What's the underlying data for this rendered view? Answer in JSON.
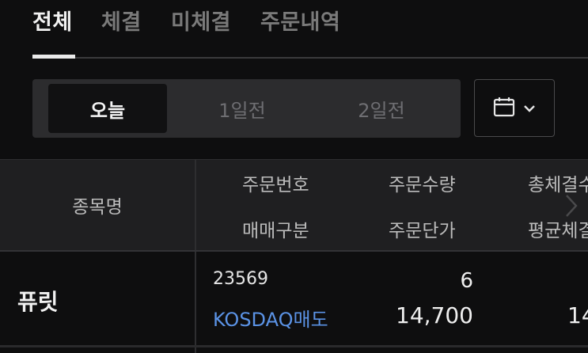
{
  "tabs": [
    {
      "label": "전체",
      "active": true
    },
    {
      "label": "체결",
      "active": false
    },
    {
      "label": "미체결",
      "active": false
    },
    {
      "label": "주문내역",
      "active": false
    }
  ],
  "date_filter": {
    "options": [
      {
        "label": "오늘",
        "active": true
      },
      {
        "label": "1일전",
        "active": false
      },
      {
        "label": "2일전",
        "active": false
      }
    ],
    "calendar_icon": "calendar-icon",
    "dropdown_icon": "chevron-down-icon"
  },
  "table": {
    "headers": {
      "stock_name": "종목명",
      "order_no": "주문번호",
      "trade_type": "매매구분",
      "order_qty": "주문수량",
      "order_price": "주문단가",
      "total_filled_partial": "총체결수",
      "avg_filled_partial": "평균체결"
    },
    "scroll_icon": "chevron-right-icon",
    "rows": [
      {
        "stock_name": "퓨릿",
        "order_no": "23569",
        "trade_type": "KOSDAQ매도",
        "order_qty": "6",
        "order_price": "14,700",
        "avg_filled_partial": "14"
      }
    ]
  },
  "colors": {
    "background": "#0e0e0f",
    "accent_blue": "#5b93e6",
    "header_bg": "#1f1f21"
  }
}
